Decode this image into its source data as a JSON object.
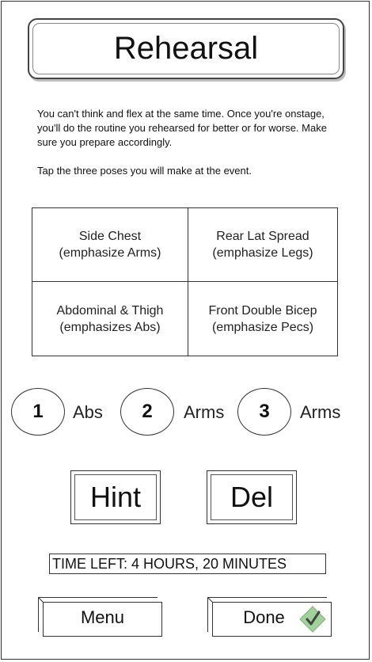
{
  "title": "Rehearsal",
  "intro": {
    "paragraph1": "You can't think and flex at the same time. Once you're onstage, you'll do the routine you rehearsed for better or for worse. Make sure you prepare accordingly.",
    "paragraph2": "Tap the three poses you will make at the event."
  },
  "poses": [
    {
      "name": "Side Chest",
      "emphasis": "(emphasize Arms)"
    },
    {
      "name": "Rear Lat Spread",
      "emphasis": "(emphasize Legs)"
    },
    {
      "name": "Abdominal & Thigh",
      "emphasis": "(emphasizes Abs)"
    },
    {
      "name": "Front Double Bicep",
      "emphasis": "(emphasize Pecs)"
    }
  ],
  "slots": [
    {
      "number": "1",
      "label": "Abs"
    },
    {
      "number": "2",
      "label": "Arms"
    },
    {
      "number": "3",
      "label": "Arms"
    }
  ],
  "buttons": {
    "hint": "Hint",
    "delete": "Del",
    "menu": "Menu",
    "done": "Done"
  },
  "timer": "TIME LEFT: 4 HOURS, 20 MINUTES",
  "icons": {
    "done": "checkmark-icon"
  },
  "colors": {
    "check_fill": "#9fd39a",
    "check_stroke": "#444444"
  }
}
